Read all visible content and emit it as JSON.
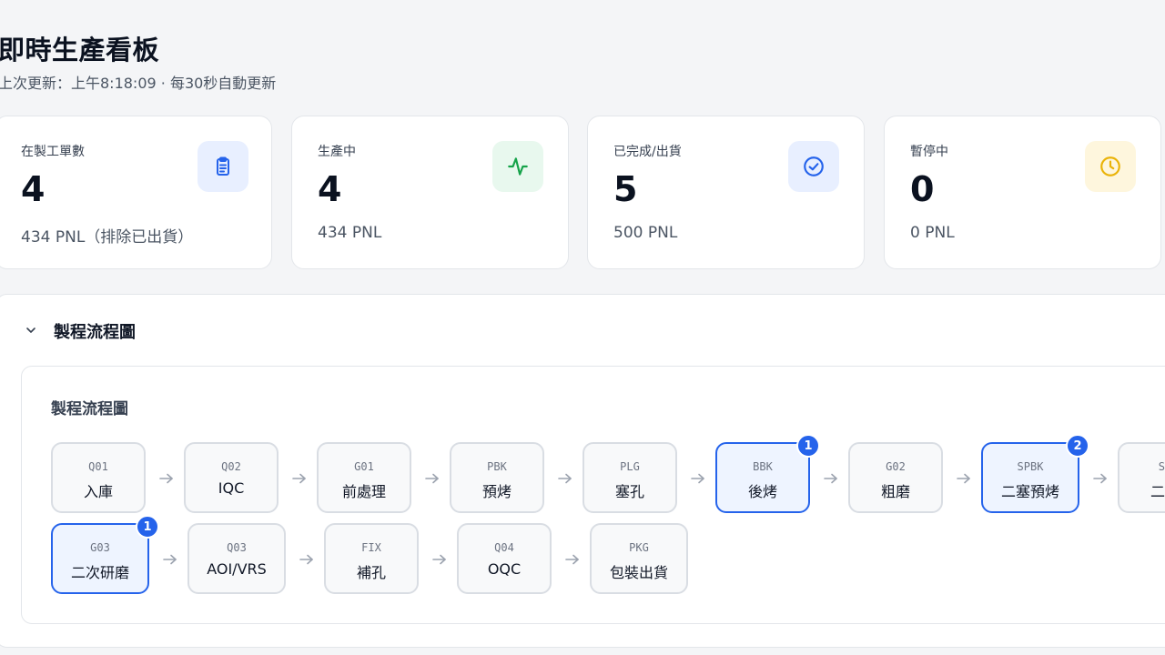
{
  "header": {
    "title": "即時生產看板",
    "subtitle": "上次更新：上午8:18:09 · 每30秒自動更新"
  },
  "stats": [
    {
      "label": "在製工單數",
      "value": "4",
      "sub": "434 PNL（排除已出貨）",
      "icon": "clipboard-icon",
      "color": "#2563eb",
      "bg": "#e8efff"
    },
    {
      "label": "生產中",
      "value": "4",
      "sub": "434 PNL",
      "icon": "activity-icon",
      "color": "#16a34a",
      "bg": "#e8f8ee"
    },
    {
      "label": "已完成/出貨",
      "value": "5",
      "sub": "500 PNL",
      "icon": "check-circle-icon",
      "color": "#2563eb",
      "bg": "#e8efff"
    },
    {
      "label": "暫停中",
      "value": "0",
      "sub": "0 PNL",
      "icon": "clock-icon",
      "color": "#eab308",
      "bg": "#fef6dd"
    }
  ],
  "panel": {
    "title": "製程流程圖",
    "toggle_icon": "chevron-down-icon",
    "flow_title": "製程流程圖"
  },
  "flow": {
    "row1": [
      {
        "code": "Q01",
        "name": "入庫"
      },
      {
        "code": "Q02",
        "name": "IQC"
      },
      {
        "code": "G01",
        "name": "前處理"
      },
      {
        "code": "PBK",
        "name": "預烤"
      },
      {
        "code": "PLG",
        "name": "塞孔"
      },
      {
        "code": "BBK",
        "name": "後烤",
        "badge": "1"
      },
      {
        "code": "G02",
        "name": "粗磨"
      },
      {
        "code": "SPBK",
        "name": "二塞預烤",
        "badge": "2"
      },
      {
        "code": "SP",
        "name": "二次"
      }
    ],
    "row2": [
      {
        "code": "G03",
        "name": "二次研磨",
        "badge": "1"
      },
      {
        "code": "Q03",
        "name": "AOI/VRS"
      },
      {
        "code": "FIX",
        "name": "補孔"
      },
      {
        "code": "Q04",
        "name": "OQC"
      },
      {
        "code": "PKG",
        "name": "包裝出貨"
      }
    ],
    "arrow_icon": "arrow-right-icon",
    "active_color": "#2563eb"
  }
}
